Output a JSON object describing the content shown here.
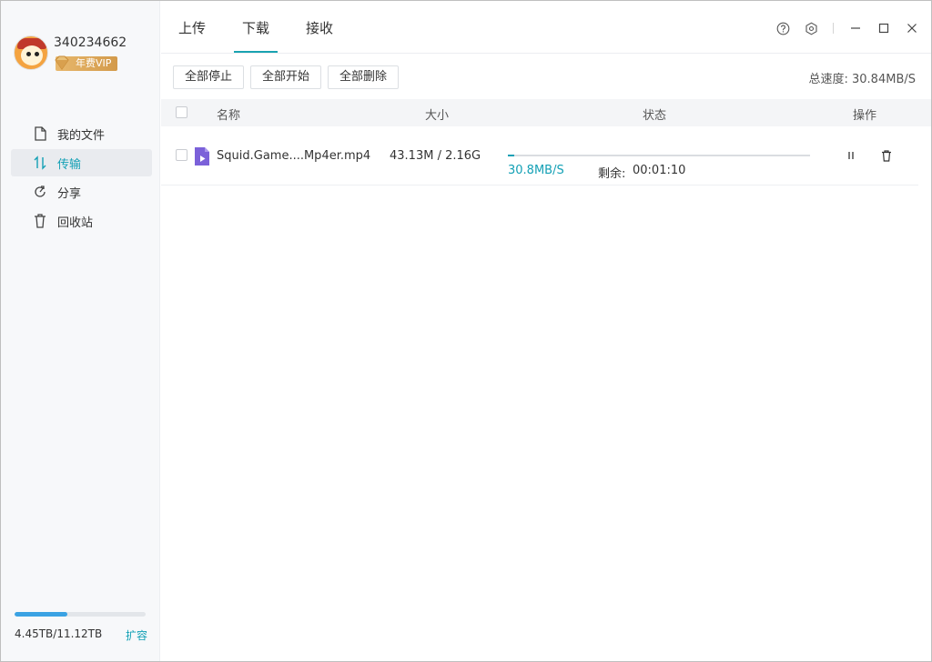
{
  "user": {
    "id": "340234662",
    "vip_label": "年费VIP"
  },
  "sidebar": {
    "items": [
      {
        "label": "我的文件",
        "icon": "file-icon"
      },
      {
        "label": "传输",
        "icon": "transfer-icon"
      },
      {
        "label": "分享",
        "icon": "share-icon"
      },
      {
        "label": "回收站",
        "icon": "trash-icon"
      }
    ],
    "active_index": 1
  },
  "storage": {
    "used_text": "4.45TB/11.12TB",
    "used_fraction": 0.4,
    "expand_label": "扩容"
  },
  "tabs": [
    {
      "label": "上传"
    },
    {
      "label": "下载"
    },
    {
      "label": "接收"
    }
  ],
  "active_tab": 1,
  "toolbar": {
    "stop_all": "全部停止",
    "start_all": "全部开始",
    "delete_all": "全部删除",
    "total_speed": "总速度: 30.84MB/S"
  },
  "table": {
    "columns": {
      "name": "名称",
      "size": "大小",
      "status": "状态",
      "actions": "操作"
    },
    "rows": [
      {
        "name": "Squid.Game....Mp4er.mp4",
        "size": "43.13M / 2.16G",
        "progress": 0.02,
        "speed": "30.8MB/S",
        "remaining_label": "剩余:",
        "remaining": "00:01:10"
      }
    ]
  },
  "colors": {
    "accent": "#13a0b5",
    "storage_bar": "#3aa2e3",
    "vip_gold": "#d39a4a",
    "video_icon": "#7b61d9"
  }
}
